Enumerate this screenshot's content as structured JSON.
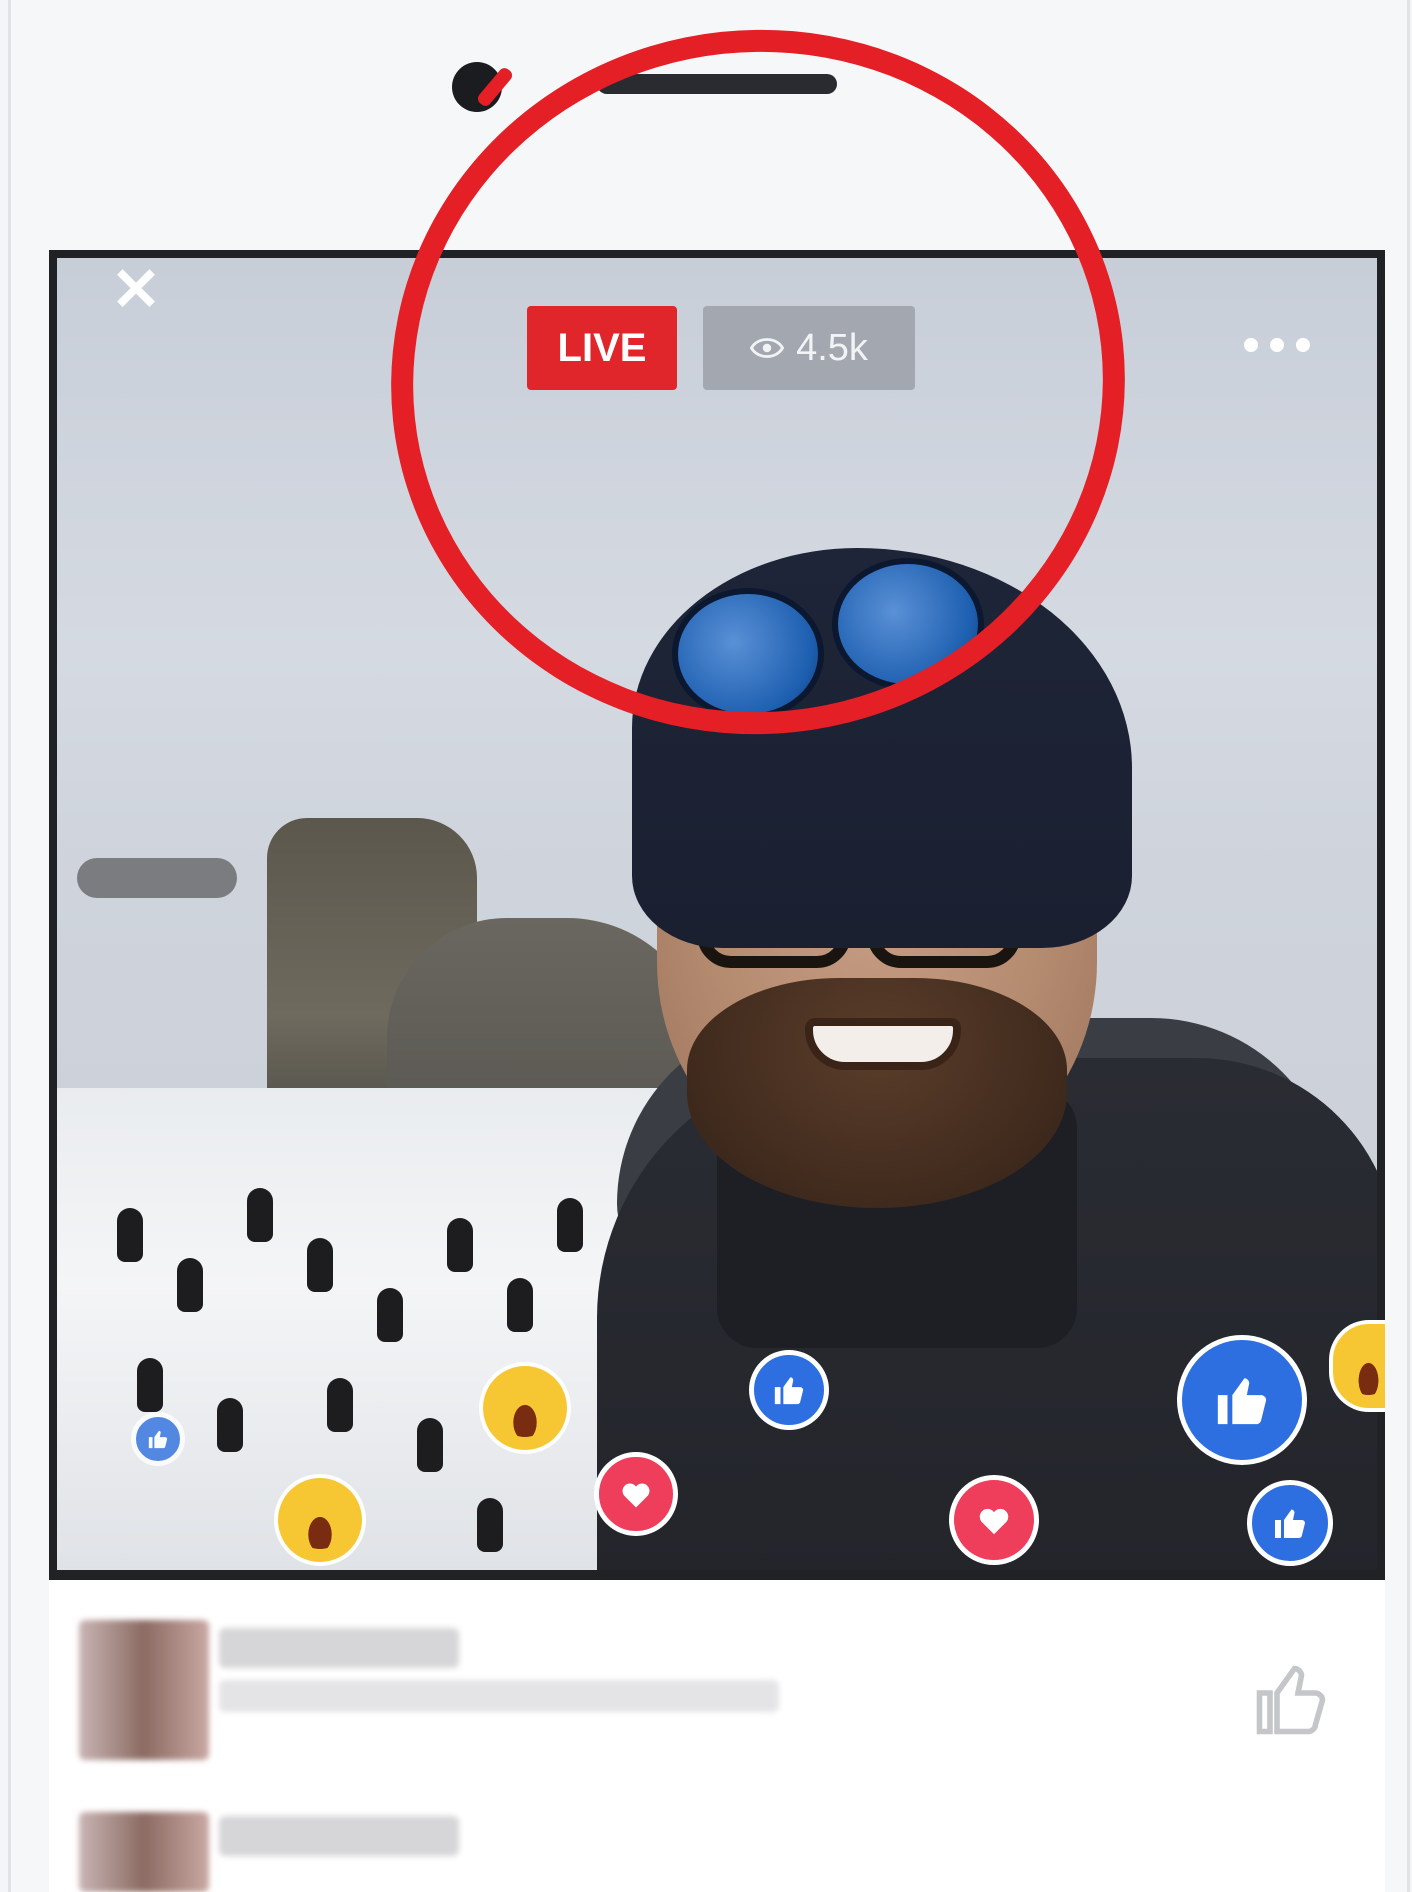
{
  "live_label": "LIVE",
  "viewer_count": "4.5k",
  "close_glyph": "✕",
  "colors": {
    "live_red": "#e0262a",
    "annotation_red": "#e41f25",
    "like_blue": "#2d6fe0",
    "love_red": "#ef3d5c",
    "haha_yellow": "#f7c733"
  },
  "icons": [
    "close-icon",
    "eye-icon",
    "more-options-icon",
    "like-icon",
    "love-icon",
    "haha-icon"
  ],
  "reactions": [
    "like",
    "like",
    "like",
    "love",
    "love",
    "haha",
    "haha",
    "haha"
  ]
}
